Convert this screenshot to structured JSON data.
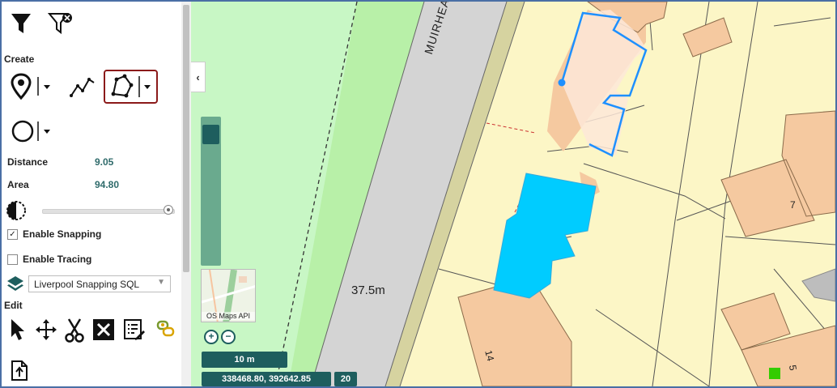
{
  "panel": {
    "create_label": "Create",
    "edit_label": "Edit",
    "distance_label": "Distance",
    "distance_value": "9.05",
    "area_label": "Area",
    "area_value": "94.80",
    "snapping_label": "Enable Snapping",
    "snapping_checked": true,
    "tracing_label": "Enable Tracing",
    "tracing_checked": false,
    "layer_select_value": "Liverpool Snapping SQL",
    "opacity_level": 1.0,
    "icons": {
      "filter": "filter-icon",
      "clear_filter": "filter-clear-icon",
      "point": "map-pin-icon",
      "line": "polyline-icon",
      "polygon": "polygon-icon",
      "circle": "circle-icon",
      "opacity": "contrast-icon",
      "layers": "layers-icon",
      "select": "cursor-icon",
      "move": "move-icon",
      "cut": "scissors-icon",
      "delete": "delete-icon",
      "attributes": "edit-list-icon",
      "link": "link-icon",
      "export": "export-icon"
    }
  },
  "map": {
    "street_label": "MUIRHEAD AVE",
    "height_label": "37.5m",
    "house_7": "7",
    "house_14": "14",
    "house_5": "5",
    "basemap_label": "OS Maps API",
    "scale_label": "10 m",
    "coordinates": "338468.80, 392642.85",
    "zoom_level": "20",
    "colors": {
      "grass": "#c8f7c5",
      "grass_dark": "#b8f0a8",
      "road": "#d4d4d4",
      "verge": "#d6d3a0",
      "land": "#fcf6c6",
      "building": "#f5c9a0",
      "selected": "#00ccff",
      "editing": "#1e90ff",
      "accent": "#1e5e5e"
    }
  }
}
